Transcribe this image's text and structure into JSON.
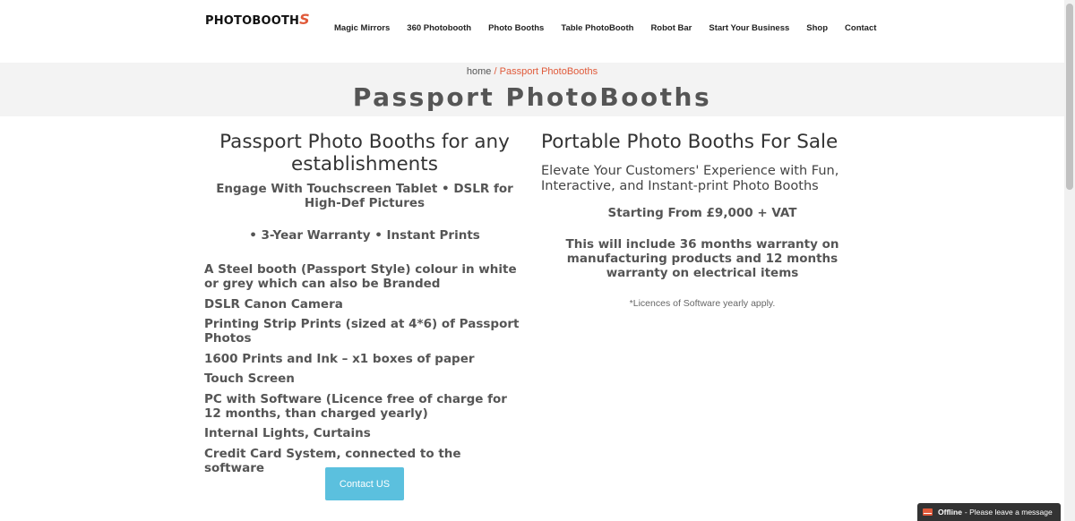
{
  "header": {
    "logo_text": "PHOTOBOOTH",
    "logo_suffix": "S",
    "nav": [
      "Magic Mirrors",
      "360 Photobooth",
      "Photo Booths",
      "Table PhotoBooth",
      "Robot Bar",
      "Start Your Business",
      "Shop",
      "Contact"
    ]
  },
  "banner": {
    "breadcrumb_home": "home",
    "breadcrumb_sep": "/",
    "breadcrumb_current": "Passport PhotoBooths",
    "title": "Passport PhotoBooths"
  },
  "left": {
    "heading": "Passport Photo Booths for any establishments",
    "subheading": "Engage With Touchscreen Tablet • DSLR for High-Def Pictures",
    "subheading2": "• 3-Year Warranty • Instant Prints",
    "features": [
      "A Steel booth (Passport Style) colour in white or grey which can also be Branded",
      "DSLR Canon Camera",
      "Printing Strip Prints (sized at 4*6) of Passport Photos",
      "1600 Prints and Ink – x1 boxes of paper",
      "Touch Screen",
      "PC with Software (Licence free of charge for 12 months, than charged yearly)",
      "Internal Lights, Curtains",
      "Credit Card System, connected to the software"
    ],
    "button": "Contact US"
  },
  "right": {
    "heading": "Portable Photo Booths For Sale",
    "lead": "Elevate Your Customers' Experience with Fun, Interactive, and Instant-print Photo Booths",
    "price": "Starting From £9,000 + VAT",
    "warranty": "This will include 36 months warranty on manufacturing products and 12 months warranty on electrical items",
    "note": "*Licences of Software yearly apply."
  },
  "chat": {
    "status": "Offline",
    "message": "- Please leave a message"
  },
  "colors": {
    "accent": "#e05a3a",
    "button": "#5bc0de",
    "banner_bg": "#f3f3f3"
  }
}
